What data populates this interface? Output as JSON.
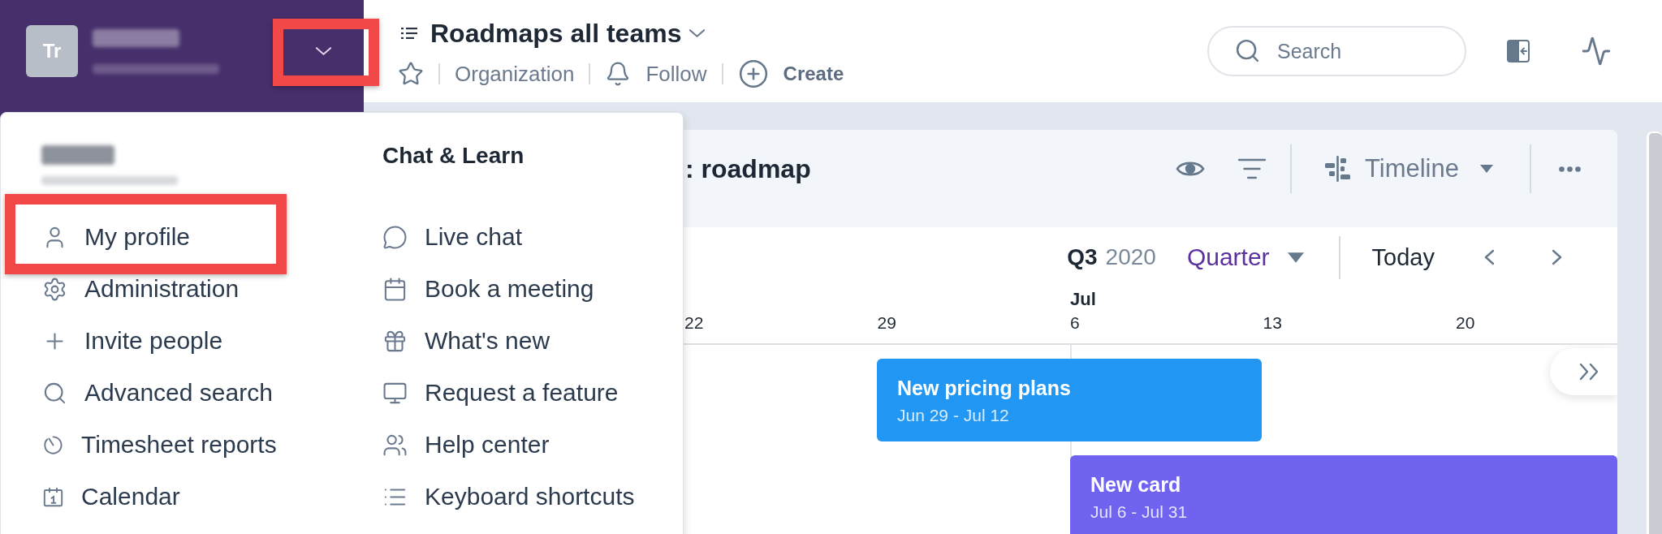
{
  "sidebar": {
    "avatar": "Tr",
    "menu_button": {
      "highlighted": true
    }
  },
  "header": {
    "title": "Roadmaps all teams",
    "actions": [
      {
        "kind": "favorite"
      },
      {
        "kind": "scope",
        "label": "Organization"
      },
      {
        "kind": "follow",
        "label": "Follow"
      },
      {
        "kind": "create",
        "label": "Create"
      }
    ],
    "search": {
      "placeholder": "Search"
    }
  },
  "account_menu": {
    "items": [
      {
        "kind": "profile",
        "label": "My profile",
        "highlighted": true
      },
      {
        "kind": "admin",
        "label": "Administration",
        "highlighted": false
      },
      {
        "kind": "invite",
        "label": "Invite people",
        "highlighted": false
      },
      {
        "kind": "search",
        "label": "Advanced search",
        "highlighted": false
      },
      {
        "kind": "timesheet",
        "label": "Timesheet reports",
        "highlighted": false
      },
      {
        "kind": "calendar",
        "label": "Calendar",
        "highlighted": false
      }
    ],
    "chat_heading": "Chat & Learn",
    "chat_items": [
      {
        "kind": "chat",
        "label": "Live chat"
      },
      {
        "kind": "meeting",
        "label": "Book a meeting"
      },
      {
        "kind": "news",
        "label": "What's new"
      },
      {
        "kind": "feature",
        "label": "Request a feature"
      },
      {
        "kind": "help",
        "label": "Help center"
      },
      {
        "kind": "shortcuts",
        "label": "Keyboard shortcuts"
      }
    ]
  },
  "board": {
    "title": ": roadmap",
    "view": "Timeline",
    "quarter": "Q3",
    "year": "2020",
    "scale": "Quarter",
    "today": "Today",
    "weeks": [
      {
        "day": "22"
      },
      {
        "day": "29"
      },
      {
        "day": "6",
        "month": "Jul"
      },
      {
        "day": "13"
      },
      {
        "day": "20"
      }
    ],
    "cards": [
      {
        "title": "New pricing plans",
        "dates": "Jun 29 - Jul 12",
        "color": "#2196f3"
      },
      {
        "title": "New card",
        "dates": "Jul 6 - Jul 31",
        "color": "#6f63f0"
      }
    ]
  }
}
